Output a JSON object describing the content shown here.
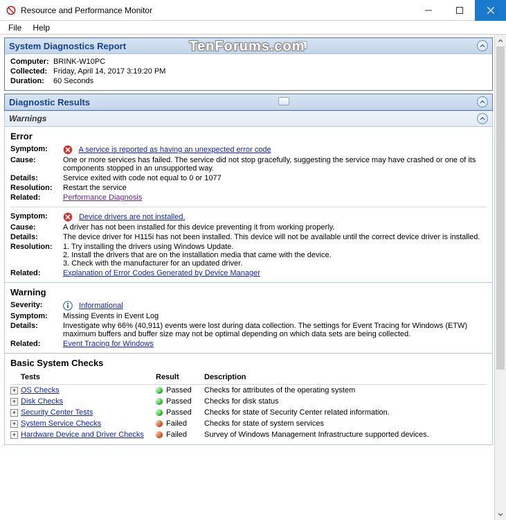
{
  "window": {
    "title": "Resource and Performance Monitor"
  },
  "menu": {
    "file": "File",
    "help": "Help"
  },
  "watermark": "TenForums.com",
  "report": {
    "title": "System Diagnostics Report",
    "computer_label": "Computer:",
    "computer_value": "BRINK-W10PC",
    "collected_label": "Collected:",
    "collected_value": "Friday, April 14, 2017 3:19:20 PM",
    "duration_label": "Duration:",
    "duration_value": "60 Seconds"
  },
  "diag": {
    "title": "Diagnostic Results",
    "warnings_header": "Warnings",
    "error_title": "Error",
    "error1": {
      "symptom_label": "Symptom:",
      "symptom_link": "A service is reported as having an unexpected error code",
      "cause_label": "Cause:",
      "cause": "One or more services has failed. The service did not stop gracefully, suggesting the service may have crashed or one of its components stopped in an unsupported way.",
      "details_label": "Details:",
      "details": "Service exited with code not equal to 0 or 1077",
      "resolution_label": "Resolution:",
      "resolution": "Restart the service",
      "related_label": "Related:",
      "related_link": "Performance Diagnosis"
    },
    "error2": {
      "symptom_label": "Symptom:",
      "symptom_link": "Device drivers are not installed.",
      "cause_label": "Cause:",
      "cause": "A driver has not been installed for this device preventing it from working properly.",
      "details_label": "Details:",
      "details": "The device driver for H115i has not been installed. This device will not be available until the correct device driver is installed.",
      "resolution_label": "Resolution:",
      "resolution1": "1. Try installing the drivers using Windows Update.",
      "resolution2": "2. Install the drivers that are on the installation media that came with the device.",
      "resolution3": "3. Check with the manufacturer for an updated driver.",
      "related_label": "Related:",
      "related_link": "Explanation of Error Codes Generated by Device Manager"
    },
    "warning_title": "Warning",
    "warning": {
      "severity_label": "Severity:",
      "severity_link": "Informational",
      "symptom_label": "Symptom:",
      "symptom": "Missing Events in Event Log",
      "details_label": "Details:",
      "details": "Investigate why 66% (40,911) events were lost during data collection. The settings for Event Tracing for Windows (ETW) maximum buffers and buffer size may not be optimal depending on which data sets are being collected.",
      "related_label": "Related:",
      "related_link": "Event Tracing for Windows"
    },
    "checks_title": "Basic System Checks",
    "checks_head": {
      "tests": "Tests",
      "result": "Result",
      "desc": "Description"
    },
    "checks": [
      {
        "name": "OS Checks",
        "result": "Passed",
        "status": "pass",
        "desc": "Checks for attributes of the operating system"
      },
      {
        "name": "Disk Checks",
        "result": "Passed",
        "status": "pass",
        "desc": "Checks for disk status"
      },
      {
        "name": "Security Center Tests",
        "result": "Passed",
        "status": "pass",
        "desc": "Checks for state of Security Center related information."
      },
      {
        "name": "System Service Checks",
        "result": "Failed",
        "status": "fail",
        "desc": "Checks for state of system services"
      },
      {
        "name": "Hardware Device and Driver Checks",
        "result": "Failed",
        "status": "fail",
        "desc": "Survey of Windows Management Infrastructure supported devices."
      }
    ]
  }
}
